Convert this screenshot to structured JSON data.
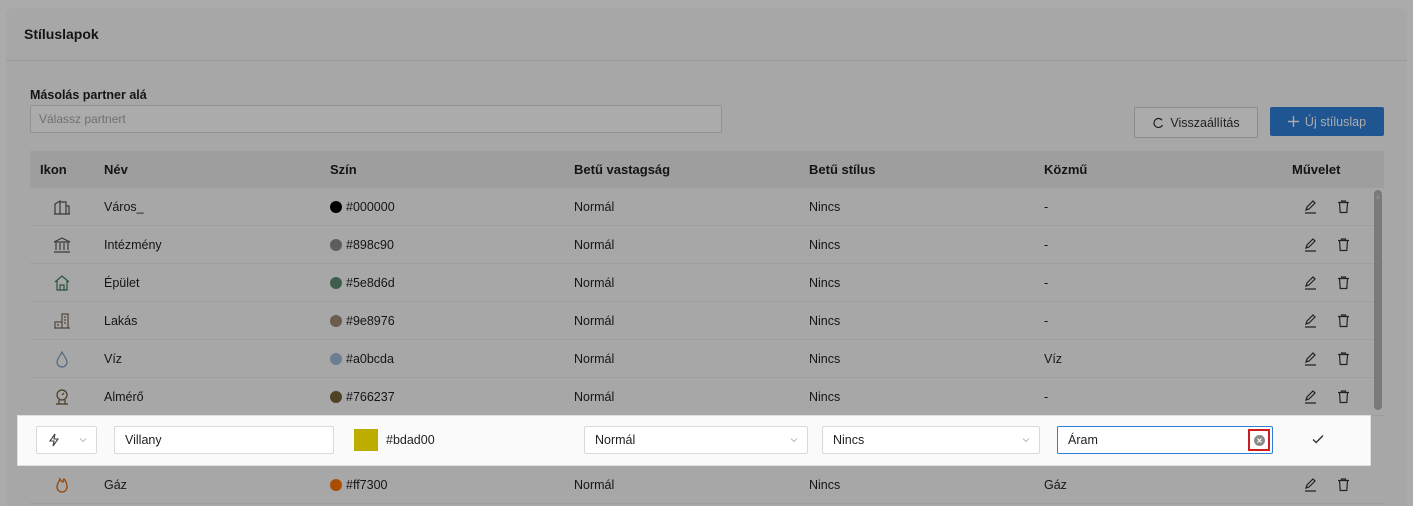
{
  "panel": {
    "title": "Stíluslapok"
  },
  "copy": {
    "label": "Másolás partner alá",
    "placeholder": "Válassz partnert",
    "value": ""
  },
  "toolbar": {
    "reset_label": "Visszaállítás",
    "new_label": "Új stíluslap",
    "accent": "#2f7fd9"
  },
  "table": {
    "headers": {
      "icon": "Ikon",
      "name": "Név",
      "color": "Szín",
      "weight": "Betű vastagság",
      "style": "Betű stílus",
      "utility": "Közmű",
      "action": "Művelet"
    },
    "rows": [
      {
        "icon": "city-icon",
        "name": "Város_",
        "color": "#000000",
        "weight": "Normál",
        "style": "Nincs",
        "utility": "-"
      },
      {
        "icon": "institution-icon",
        "name": "Intézmény",
        "color": "#898c90",
        "weight": "Normál",
        "style": "Nincs",
        "utility": "-"
      },
      {
        "icon": "building-icon",
        "name": "Épület",
        "color": "#5e8d6d",
        "weight": "Normál",
        "style": "Nincs",
        "utility": "-"
      },
      {
        "icon": "apartment-icon",
        "name": "Lakás",
        "color": "#9e8976",
        "weight": "Normál",
        "style": "Nincs",
        "utility": "-"
      },
      {
        "icon": "water-drop-icon",
        "name": "Víz",
        "color": "#a0bcda",
        "weight": "Normál",
        "style": "Nincs",
        "utility": "Víz"
      },
      {
        "icon": "meter-icon",
        "name": "Almérő",
        "color": "#766237",
        "weight": "Normál",
        "style": "Nincs",
        "utility": "-"
      }
    ],
    "edit_row": {
      "icon": "lightning-icon",
      "name": "Villany",
      "color": "#bdad00",
      "weight": "Normál",
      "style": "Nincs",
      "utility": "Áram"
    },
    "last_row": {
      "icon": "flame-icon",
      "name": "Gáz",
      "color": "#ff7300",
      "weight": "Normál",
      "style": "Nincs",
      "utility": "Gáz"
    }
  }
}
